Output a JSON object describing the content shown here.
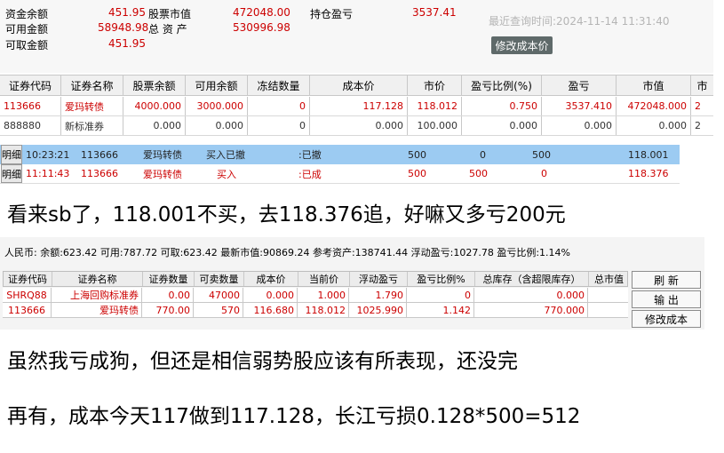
{
  "account": {
    "fund_balance_label": "资金余额",
    "fund_balance": "451.95",
    "available_label": "可用金额",
    "available": "58948.98",
    "withdrawable_label": "可取金额",
    "withdrawable": "451.95",
    "stock_value_label": "股票市值",
    "stock_value": "472048.00",
    "total_assets_label": "总 资 产",
    "total_assets": "530996.98",
    "position_pnl_label": "持仓盈亏",
    "position_pnl": "3537.41",
    "last_query": "最近查询时间:2024-11-14 11:31:40",
    "modify_cost_label": "修改成本价"
  },
  "positions": {
    "headers": [
      "证券代码",
      "证券名称",
      "股票余额",
      "可用余额",
      "冻结数量",
      "成本价",
      "市价",
      "盈亏比例(%)",
      "盈亏",
      "市值",
      "市"
    ],
    "rows": [
      [
        "113666",
        "爱玛转债",
        "4000.000",
        "3000.000",
        "0",
        "117.128",
        "118.012",
        "0.750",
        "3537.410",
        "472048.000",
        "2"
      ],
      [
        "888880",
        "新标准券",
        "0.000",
        "0.000",
        "0",
        "0.000",
        "100.000",
        "0.000",
        "0.000",
        "0.000",
        "2"
      ]
    ]
  },
  "details": [
    {
      "tag": "明细",
      "time": "10:23:21",
      "code": "113666",
      "name": "爱玛转债",
      "action": "买入已撤",
      "status": ":已撤",
      "qty": "500",
      "filled": "0",
      "remain": "500",
      "price": "118.001"
    },
    {
      "tag": "明细",
      "time": "11:11:43",
      "code": "113666",
      "name": "爱玛转债",
      "action": "买入",
      "status": ":已成",
      "qty": "500",
      "filled": "500",
      "remain": "0",
      "price": "118.376"
    }
  ],
  "comments": {
    "line1": "看来sb了，118.001不买，去118.376追，好嘛又多亏200元",
    "line2": "虽然我亏成狗，但还是相信弱势股应该有所表现，还没完",
    "line3": "再有，成本今天117做到117.128，长江亏损0.128*500=512"
  },
  "account2": {
    "summary": "人民币: 余额:623.42  可用:787.72  可取:623.42  最新市值:90869.24  参考资产:138741.44  浮动盈亏:1027.78  盈亏比例:1.14%",
    "headers": [
      "证券代码",
      "证券名称",
      "证券数量",
      "可卖数量",
      "成本价",
      "当前价",
      "浮动盈亏",
      "盈亏比例%",
      "总库存（含超限库存）",
      "总市值"
    ],
    "rows": [
      [
        "SHRQ88",
        "上海回购标准券",
        "0.00",
        "47000",
        "0.000",
        "1.000",
        "1.790",
        "0",
        "0.000",
        ""
      ],
      [
        "113666",
        "爱玛转债",
        "770.00",
        "570",
        "116.680",
        "118.012",
        "1025.990",
        "1.142",
        "770.000",
        ""
      ]
    ],
    "buttons": [
      "刷 新",
      "输 出",
      "修改成本"
    ]
  }
}
